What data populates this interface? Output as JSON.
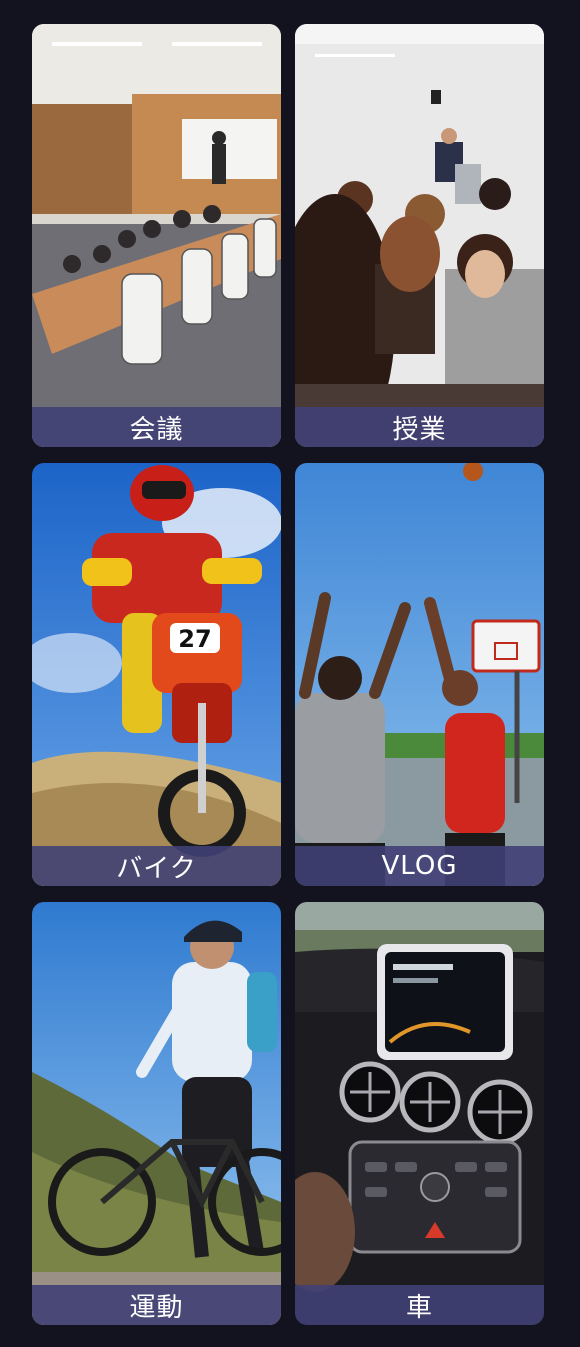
{
  "tiles": [
    {
      "label": "会議",
      "scene": "conference-room"
    },
    {
      "label": "授業",
      "scene": "lecture-audience"
    },
    {
      "label": "バイク",
      "scene": "motocross-rider"
    },
    {
      "label": "VLOG",
      "scene": "basketball-players"
    },
    {
      "label": "運動",
      "scene": "mountain-biker"
    },
    {
      "label": "車",
      "scene": "car-dashboard"
    }
  ],
  "colors": {
    "background": "#13131f",
    "label_bar": "#404076",
    "label_text": "#ffffff"
  }
}
